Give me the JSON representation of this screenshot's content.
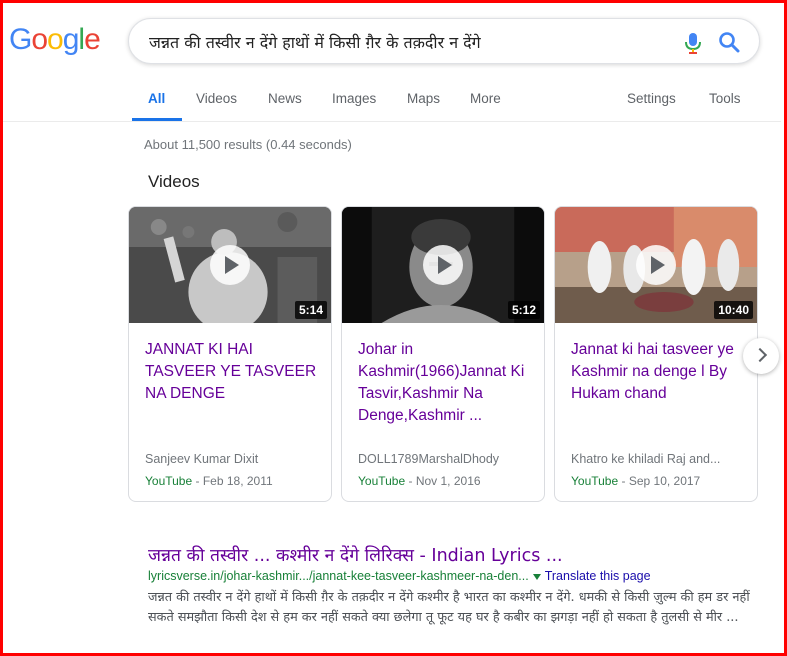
{
  "logo": {
    "letters": [
      "G",
      "o",
      "o",
      "g",
      "l",
      "e"
    ],
    "colors": [
      "#4285f4",
      "#ea4335",
      "#fbbc05",
      "#4285f4",
      "#34a853",
      "#ea4335"
    ]
  },
  "search": {
    "query": "जन्नत की तस्वीर न देंगे हाथों में किसी ग़ैर के तक़दीर न देंगे"
  },
  "tabs": [
    {
      "label": "All",
      "active": true
    },
    {
      "label": "Videos"
    },
    {
      "label": "News"
    },
    {
      "label": "Images"
    },
    {
      "label": "Maps"
    },
    {
      "label": "More"
    },
    {
      "label": "Settings"
    },
    {
      "label": "Tools"
    }
  ],
  "result_stats": "About 11,500 results (0.44 seconds)",
  "videos": {
    "heading": "Videos",
    "cards": [
      {
        "title": "JANNAT KI HAI TASVEER YE TASVEER NA DENGE",
        "duration": "5:14",
        "author": "Sanjeev Kumar Dixit",
        "source": "YouTube",
        "date": "- Feb 18, 2011"
      },
      {
        "title": "Johar in Kashmir(1966)Jannat Ki Tasvir,Kashmir Na Denge,Kashmir ...",
        "duration": "5:12",
        "author": "DOLL1789MarshalDhody",
        "source": "YouTube",
        "date": "- Nov 1, 2016"
      },
      {
        "title": "Jannat ki hai tasveer ye Kashmir na denge l By Hukam chand",
        "duration": "10:40",
        "author": "Khatro ke khiladi Raj and...",
        "source": "YouTube",
        "date": "- Sep 10, 2017"
      }
    ]
  },
  "result": {
    "title": "जन्नत की तस्वीर ... कश्मीर न देंगे लिरिक्स - Indian Lyrics ...",
    "url": "lyricsverse.in/johar-kashmir.../jannat-kee-tasveer-kashmeer-na-den...",
    "translate": "Translate this page",
    "snippet": "जन्नत की तस्वीर न देंगे हाथों में किसी ग़ैर के तक़दीर न देंगे कश्मीर है भारत का कश्मीर न देंगे. धमकी से किसी ज़ुल्म की हम डर नहीं सकते समझौता किसी देश से हम कर नहीं सकते क्या छलेगा तू फूट यह घर है कबीर का झगड़ा नहीं हो सकता है तुलसी से मीर ..."
  },
  "colors": {
    "tab_active": "#1a73e8",
    "visited_link": "#660099",
    "url_green": "#188038",
    "frame_border": "#ff0000"
  }
}
